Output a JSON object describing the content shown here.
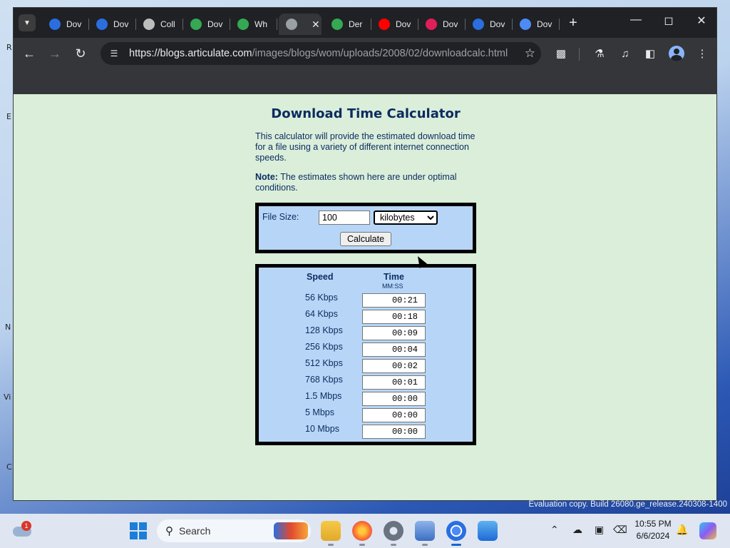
{
  "desktop_left_letters": [
    "R",
    "E",
    "N",
    "Vi",
    "C"
  ],
  "browser": {
    "tabs": [
      {
        "label": "Dov",
        "icon": "blue-circle-icon",
        "color": "#2a6ee0"
      },
      {
        "label": "Dov",
        "icon": "blue-circle-icon",
        "color": "#2a6ee0"
      },
      {
        "label": "Coll",
        "icon": "leaf-icon",
        "color": "#bdbdbd"
      },
      {
        "label": "Dov",
        "icon": "download-arrow-icon",
        "color": "#34a853"
      },
      {
        "label": "Wh",
        "icon": "download-arrow-icon",
        "color": "#34a853"
      },
      {
        "label": "",
        "icon": "globe-icon",
        "color": "#9aa0a6",
        "active": true
      },
      {
        "label": "Der",
        "icon": "drive-icon",
        "color": "#34a853"
      },
      {
        "label": "Dov",
        "icon": "youtube-icon",
        "color": "#ff0000"
      },
      {
        "label": "Dov",
        "icon": "slack-icon",
        "color": "#e01e5a"
      },
      {
        "label": "Dov",
        "icon": "blue-circle-icon",
        "color": "#2a6ee0"
      },
      {
        "label": "Dov",
        "icon": "download-arrow-icon",
        "color": "#4c8bf5"
      }
    ],
    "url_host": "https://blogs.articulate.com",
    "url_path": "/images/blogs/wom/uploads/2008/02/downloadcalc.html"
  },
  "calculator": {
    "title": "Download Time Calculator",
    "intro": "This calculator will provide the estimated download time for a file using a variety of different internet connection speeds.",
    "note_label": "Note:",
    "note_text": " The estimates shown here are under optimal conditions.",
    "file_size_label": "File Size:",
    "file_size_value": "100",
    "unit_selected": "kilobytes",
    "calculate_label": "Calculate",
    "speed_header": "Speed",
    "time_header": "Time",
    "time_subheader": "MM:SS",
    "results": [
      {
        "speed": "56 Kbps",
        "time": "00:21"
      },
      {
        "speed": "64 Kbps",
        "time": "00:18"
      },
      {
        "speed": "128 Kbps",
        "time": "00:09"
      },
      {
        "speed": "256 Kbps",
        "time": "00:04"
      },
      {
        "speed": "512 Kbps",
        "time": "00:02"
      },
      {
        "speed": "768 Kbps",
        "time": "00:01"
      },
      {
        "speed": "1.5 Mbps",
        "time": "00:00"
      },
      {
        "speed": "5 Mbps",
        "time": "00:00"
      },
      {
        "speed": "10 Mbps",
        "time": "00:00"
      }
    ]
  },
  "watermark": "Evaluation copy. Build 26080.ge_release.240308-1400",
  "taskbar": {
    "weather_badge": "1",
    "search_placeholder": "Search",
    "time": "10:55 PM",
    "date": "6/6/2024"
  }
}
